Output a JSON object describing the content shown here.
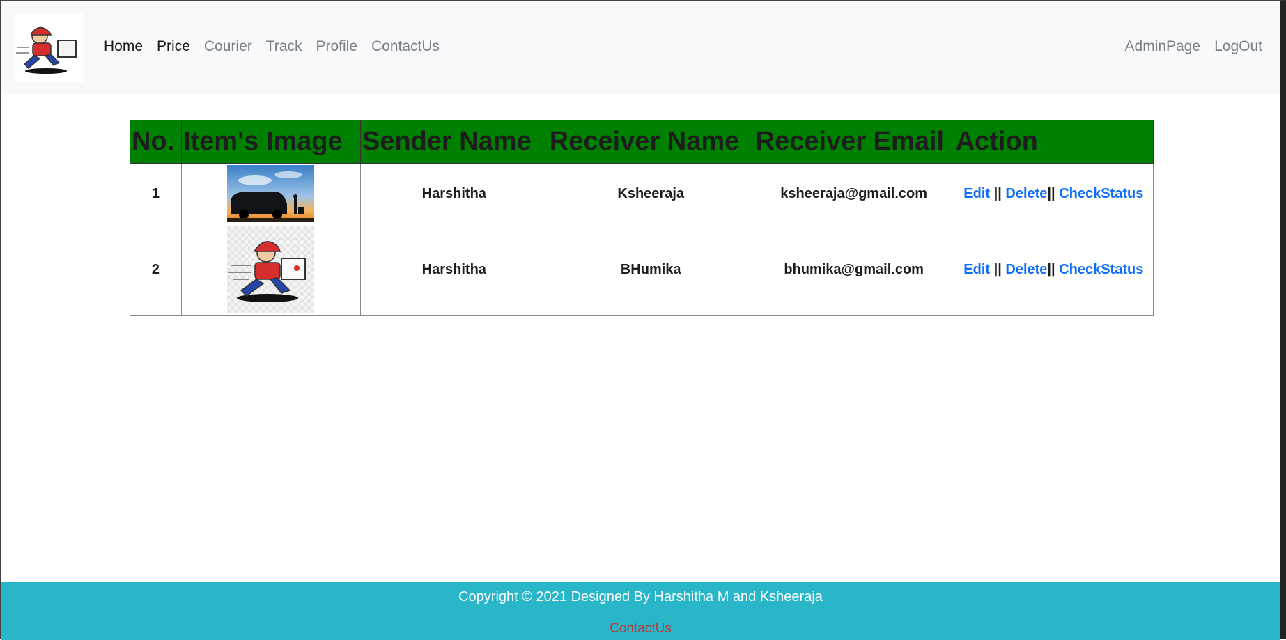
{
  "nav": {
    "links": [
      "Home",
      "Price",
      "Courier",
      "Track",
      "Profile",
      "ContactUs"
    ],
    "right_links": [
      "AdminPage",
      "LogOut"
    ]
  },
  "table": {
    "headers": [
      "No.",
      "Item's Image",
      "Sender Name",
      "Receiver Name",
      "Receiver Email",
      "Action"
    ],
    "rows": [
      {
        "no": "1",
        "sender": "Harshitha",
        "receiver": "Ksheeraja",
        "email": "ksheeraja@gmail.com",
        "image_icon": "delivery-van-sunset-photo"
      },
      {
        "no": "2",
        "sender": "Harshitha",
        "receiver": "BHumika",
        "email": "bhumika@gmail.com",
        "image_icon": "courier-mascot-photo"
      }
    ],
    "actions": {
      "edit": "Edit",
      "delete": "Delete",
      "check": "CheckStatus",
      "sep": "||"
    }
  },
  "footer": {
    "copyright": "Copyright © 2021 Designed By Harshitha M and Ksheeraja",
    "link": "ContactUs"
  },
  "colors": {
    "header_bg": "#008000",
    "footer_bg": "#2ab6c9",
    "link": "#0d6efd"
  }
}
